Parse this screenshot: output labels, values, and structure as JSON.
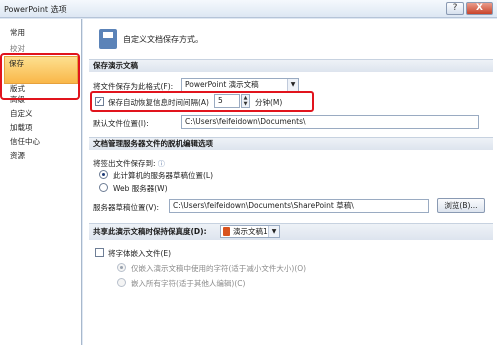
{
  "window": {
    "title": "PowerPoint 选项",
    "help_label": "?",
    "close_label": "X"
  },
  "sidebar": {
    "items": [
      {
        "label": "常用"
      },
      {
        "label": "校对"
      },
      {
        "label": "保存"
      },
      {
        "label": "版式"
      },
      {
        "label": "高级"
      },
      {
        "label": "自定义"
      },
      {
        "label": "加载项"
      },
      {
        "label": "信任中心"
      },
      {
        "label": "资源"
      }
    ],
    "selected_index": 2
  },
  "header": {
    "text": "自定义文档保存方式。"
  },
  "save_section": {
    "title": "保存演示文稿",
    "format_label": "将文件保存为此格式(F):",
    "format_value": "PowerPoint 演示文稿",
    "autosave_label": "保存自动恢复信息时间间隔(A)",
    "autosave_checked": true,
    "autosave_value": "5",
    "autosave_unit": "分钟(M)",
    "default_location_label": "默认文件位置(I):",
    "default_location_value": "C:\\Users\\feifeidown\\Documents\\"
  },
  "offline_section": {
    "title": "文档管理服务器文件的脱机编辑选项",
    "checkout_label": "将签出文件保存到:",
    "option_local": "此计算机的服务器草稿位置(L)",
    "option_web": "Web 服务器(W)",
    "drafts_label": "服务器草稿位置(V):",
    "drafts_value": "C:\\Users\\feifeidown\\Documents\\SharePoint 草稿\\",
    "browse_label": "浏览(B)..."
  },
  "fidelity_section": {
    "title": "共享此演示文稿时保持保真度(D):",
    "doc_value": "演示文稿1",
    "embed_label": "将字体嵌入文件(E)",
    "embed_checked": false,
    "option_used_chars": "仅嵌入演示文稿中使用的字符(适于减小文件大小)(O)",
    "option_all_chars": "嵌入所有字符(适于其他人编辑)(C)"
  }
}
